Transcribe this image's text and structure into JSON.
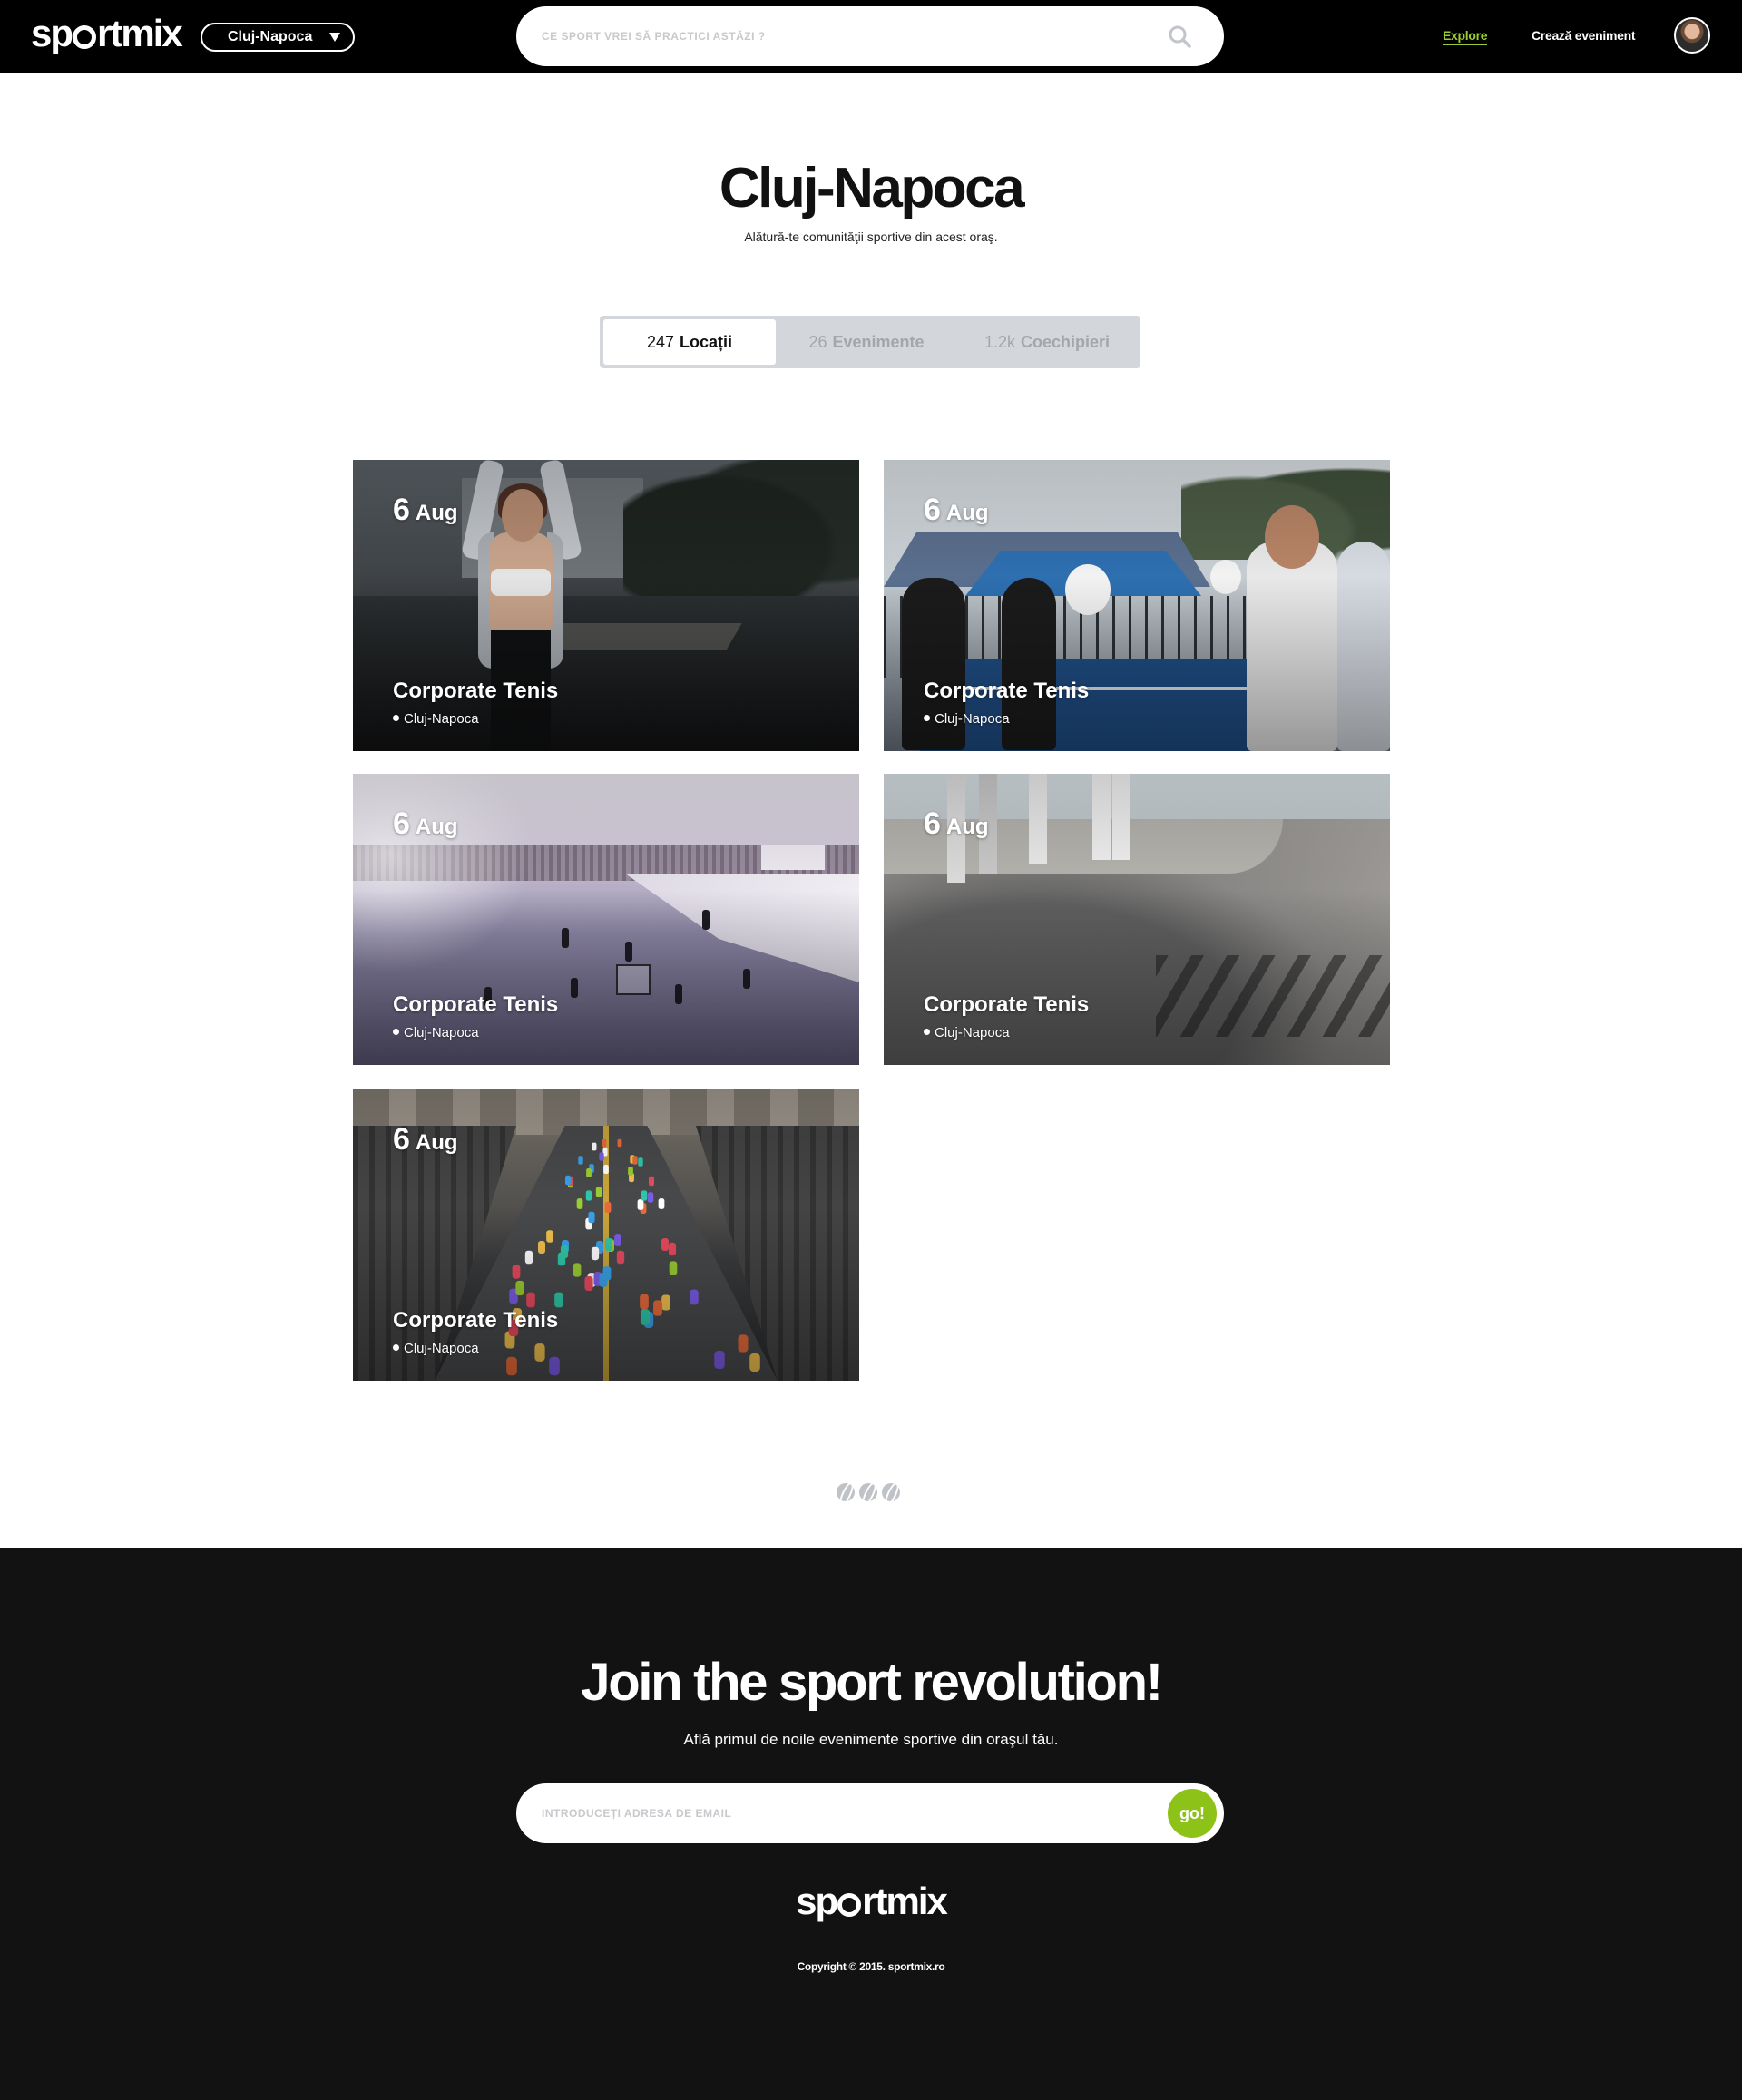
{
  "brand": {
    "logo_prefix": "sp",
    "logo_suffix": "rtmix"
  },
  "nav": {
    "city": "Cluj-Napoca",
    "search_placeholder": "CE SPORT VREI SĂ PRACTICI ASTĂZI ?",
    "explore": "Explore",
    "create_event": "Crează eveniment",
    "accent_color": "#9acd32"
  },
  "hero": {
    "title": "Cluj-Napoca",
    "subtitle": "Alătură-te comunităţii sportive din acest oraş."
  },
  "tabs": [
    {
      "count": "247",
      "label": "Locații",
      "active": true
    },
    {
      "count": "26",
      "label": "Evenimente",
      "active": false
    },
    {
      "count": "1.2k",
      "label": "Coechipieri",
      "active": false
    }
  ],
  "cards": [
    {
      "day": "6",
      "month": "Aug",
      "title": "Corporate Tenis",
      "location": "Cluj-Napoca"
    },
    {
      "day": "6",
      "month": "Aug",
      "title": "Corporate Tenis",
      "location": "Cluj-Napoca"
    },
    {
      "day": "6",
      "month": "Aug",
      "title": "Corporate Tenis",
      "location": "Cluj-Napoca"
    },
    {
      "day": "6",
      "month": "Aug",
      "title": "Corporate Tenis",
      "location": "Cluj-Napoca"
    },
    {
      "day": "6",
      "month": "Aug",
      "title": "Corporate Tenis",
      "location": "Cluj-Napoca"
    }
  ],
  "footer": {
    "title": "Join the sport revolution!",
    "subtitle": "Află primul de noile evenimente sportive din oraşul tău.",
    "email_placeholder": "INTRODUCEȚI ADRESA DE EMAIL",
    "go_label": "go!",
    "go_color": "#8dc219",
    "copyright": "Copyright © 2015. sportmix.ro"
  }
}
